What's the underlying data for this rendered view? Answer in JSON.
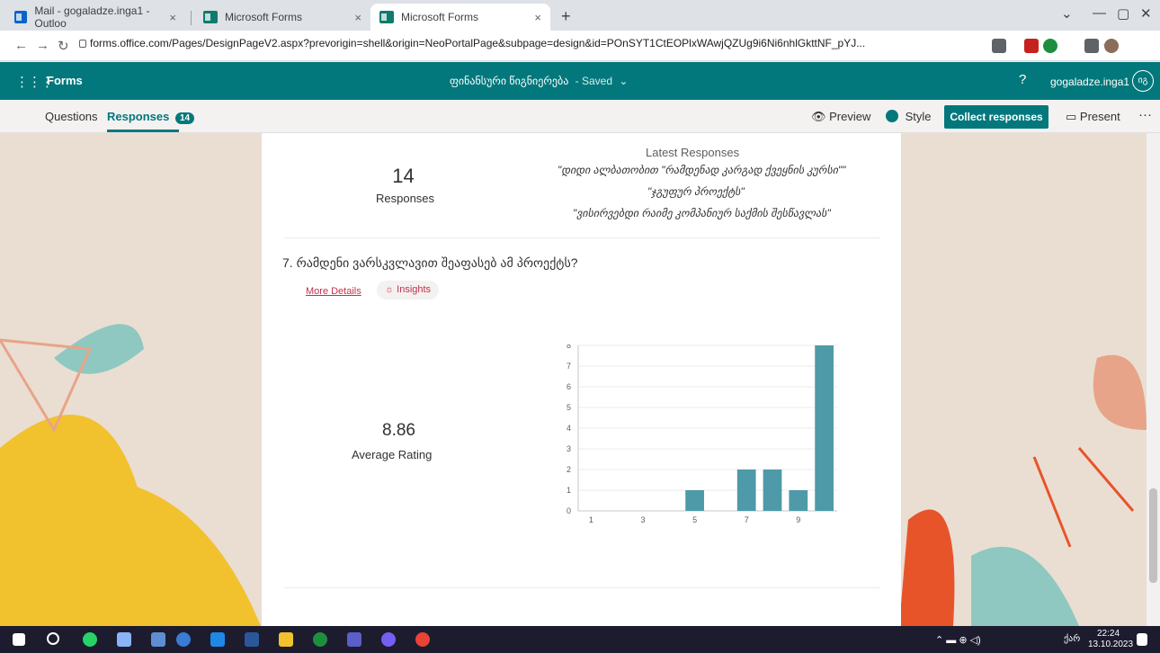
{
  "browser": {
    "tabs": [
      {
        "title": "Mail - gogaladze.inga1 - Outloo"
      },
      {
        "title": "Microsoft Forms"
      },
      {
        "title": "Microsoft Forms"
      }
    ],
    "url": "forms.office.com/Pages/DesignPageV2.aspx?prevorigin=shell&origin=NeoPortalPage&subpage=design&id=POnSYT1CtEOPlxWAwjQZUg9i6Ni6nhlGkttNF_pYJ..."
  },
  "forms_header": {
    "app_name": "Forms",
    "form_title": "ფინანსური წიგნიერება",
    "saved_status": "- Saved",
    "help": "?",
    "user_name": "gogaladze.inga1",
    "avatar_initials": "იგ"
  },
  "subbar": {
    "questions_tab": "Questions",
    "responses_tab": "Responses",
    "responses_count": "14",
    "preview": "Preview",
    "style": "Style",
    "collect": "Collect responses",
    "present": "Present",
    "more": "···"
  },
  "summary": {
    "latest_heading": "Latest Responses",
    "count": "14",
    "count_label": "Responses",
    "latest": [
      "\"დიდი ალბათობით \"რამდენად კარგად ქვეყნის კურსი\"\"",
      "\"ჯგუფურ პროექტს\"",
      "\"ვისირვებდი რაიმე კომპანიურ საქმის შესწავლას\""
    ]
  },
  "question": {
    "title": "7. რამდენი ვარსკვლავით შეაფასებ ამ პროექტს?",
    "more_details": "More Details",
    "insights": "Insights",
    "average_value": "8.86",
    "average_label": "Average Rating"
  },
  "chart_data": {
    "type": "bar",
    "categories": [
      "1",
      "2",
      "3",
      "4",
      "5",
      "6",
      "7",
      "8",
      "9",
      "10"
    ],
    "x_tick_labels": [
      "1",
      "3",
      "5",
      "7",
      "9"
    ],
    "values": [
      0,
      0,
      0,
      0,
      1,
      0,
      2,
      2,
      1,
      8
    ],
    "ylim": [
      0,
      8
    ],
    "y_ticks": [
      "0",
      "1",
      "2",
      "3",
      "4",
      "5",
      "6",
      "7",
      "8"
    ],
    "color": "#4e9aa8",
    "grid": true
  },
  "taskbar": {
    "time": "22:24",
    "date": "13.10.2023",
    "lang": "ქარ"
  }
}
